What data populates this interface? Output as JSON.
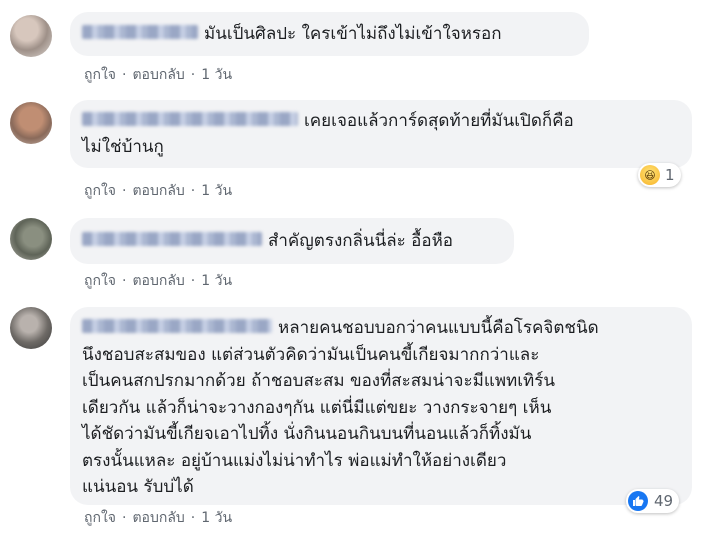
{
  "comments": [
    {
      "text": "มันเป็นศิลปะ ใครเข้าไม่ถึงไม่เข้าใจหรอก",
      "actions": {
        "like": "ถูกใจ",
        "reply": "ตอบกลับ",
        "time": "1 วัน"
      }
    },
    {
      "text_line1": "เคยเจอแล้วการ์ดสุดท้ายที่มันเปิดก็คือ",
      "text_line2": "ไม่ใช่บ้านกู",
      "reaction": {
        "icon": "haha-emoji-icon",
        "count": "1"
      },
      "actions": {
        "like": "ถูกใจ",
        "reply": "ตอบกลับ",
        "time": "1 วัน"
      }
    },
    {
      "text": "สำคัญตรงกลิ่นนี่ล่ะ อื้อหือ",
      "actions": {
        "like": "ถูกใจ",
        "reply": "ตอบกลับ",
        "time": "1 วัน"
      }
    },
    {
      "lines": [
        "หลายคนชอบบอกว่าคนแบบนี้คือโรคจิตชนิด",
        "นึงชอบสะสมของ แต่ส่วนตัวคิดว่ามันเป็นคนขี้เกียจมากกว่าและ",
        "เป็นคนสกปรกมากด้วย ถ้าชอบสะสม ของที่สะสมน่าจะมีแพทเทิร์น",
        "เดียวกัน แล้วก็น่าจะวางกองๆกัน แต่นี่มีแต่ขยะ วางกระจายๆ เห็น",
        "ได้ชัดว่ามันขี้เกียจเอาไปทิ้ง นั่งกินนอนกินบนที่นอนแล้วก็ทิ้งมัน",
        "ตรงนั้นแหละ อยู่บ้านแม่งไม่น่าทำไร พ่อแม่ทำให้อย่างเดียว",
        "แน่นอน รับบ่ได้"
      ],
      "reaction": {
        "icon": "like-thumb-icon",
        "count": "49"
      },
      "actions": {
        "like": "ถูกใจ",
        "reply": "ตอบกลับ",
        "time": "1 วัน"
      }
    }
  ],
  "colors": {
    "bubble": "#f2f3f5",
    "meta": "#606770",
    "like_blue": "#1877f2",
    "text": "#1c1e21"
  }
}
